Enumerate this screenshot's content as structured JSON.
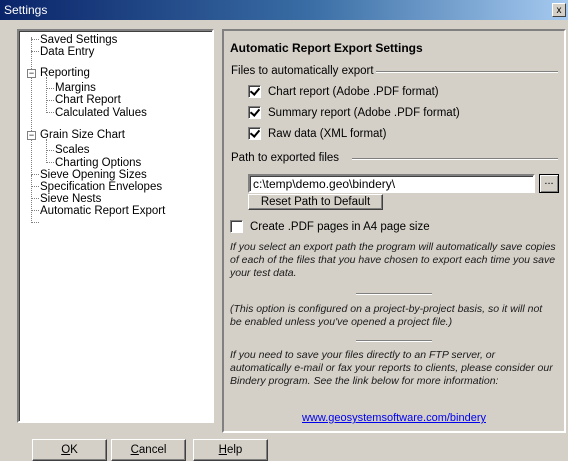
{
  "window": {
    "title": "Settings",
    "close_glyph": "x"
  },
  "tree": {
    "items": [
      {
        "label": "Saved Settings"
      },
      {
        "label": "Data Entry"
      },
      {
        "label": "Reporting"
      },
      {
        "label": "Margins"
      },
      {
        "label": "Chart Report"
      },
      {
        "label": "Calculated Values"
      },
      {
        "label": "Grain Size Chart"
      },
      {
        "label": "Scales"
      },
      {
        "label": "Charting Options"
      },
      {
        "label": "Sieve Opening Sizes"
      },
      {
        "label": "Specification Envelopes"
      },
      {
        "label": "Sieve Nests"
      },
      {
        "label": "Automatic Report Export"
      }
    ],
    "expander_glyph": "−"
  },
  "panel": {
    "title": "Automatic Report Export Settings",
    "files_group_label": "Files to automatically export",
    "checkboxes": [
      {
        "label": "Chart report (Adobe .PDF format)",
        "checked": true
      },
      {
        "label": "Summary report (Adobe .PDF format)",
        "checked": true
      },
      {
        "label": "Raw data (XML format)",
        "checked": true
      }
    ],
    "path_group_label": "Path to exported files",
    "path_value": "c:\\temp\\demo.geo\\bindery\\",
    "browse_label": "...",
    "reset_label": "Reset Path to Default",
    "a4": {
      "label": "Create .PDF pages in A4 page size",
      "checked": false
    },
    "note1": "If you select an export path the program will automatically save copies of each of the files that you have chosen to export each time you save your test data.",
    "note2": "(This option is configured on a project-by-project basis, so it will not be enabled unless you've opened a project file.)",
    "note3": "If you need to save your files directly to an FTP server, or automatically e-mail or fax your reports to clients, please consider our Bindery program. See the link below for more information:",
    "link": "www.geosystemsoftware.com/bindery"
  },
  "buttons": {
    "ok_mnemonic": "O",
    "ok_rest": "K",
    "cancel_mnemonic": "C",
    "cancel_rest": "ancel",
    "help_mnemonic": "H",
    "help_rest": "elp"
  }
}
